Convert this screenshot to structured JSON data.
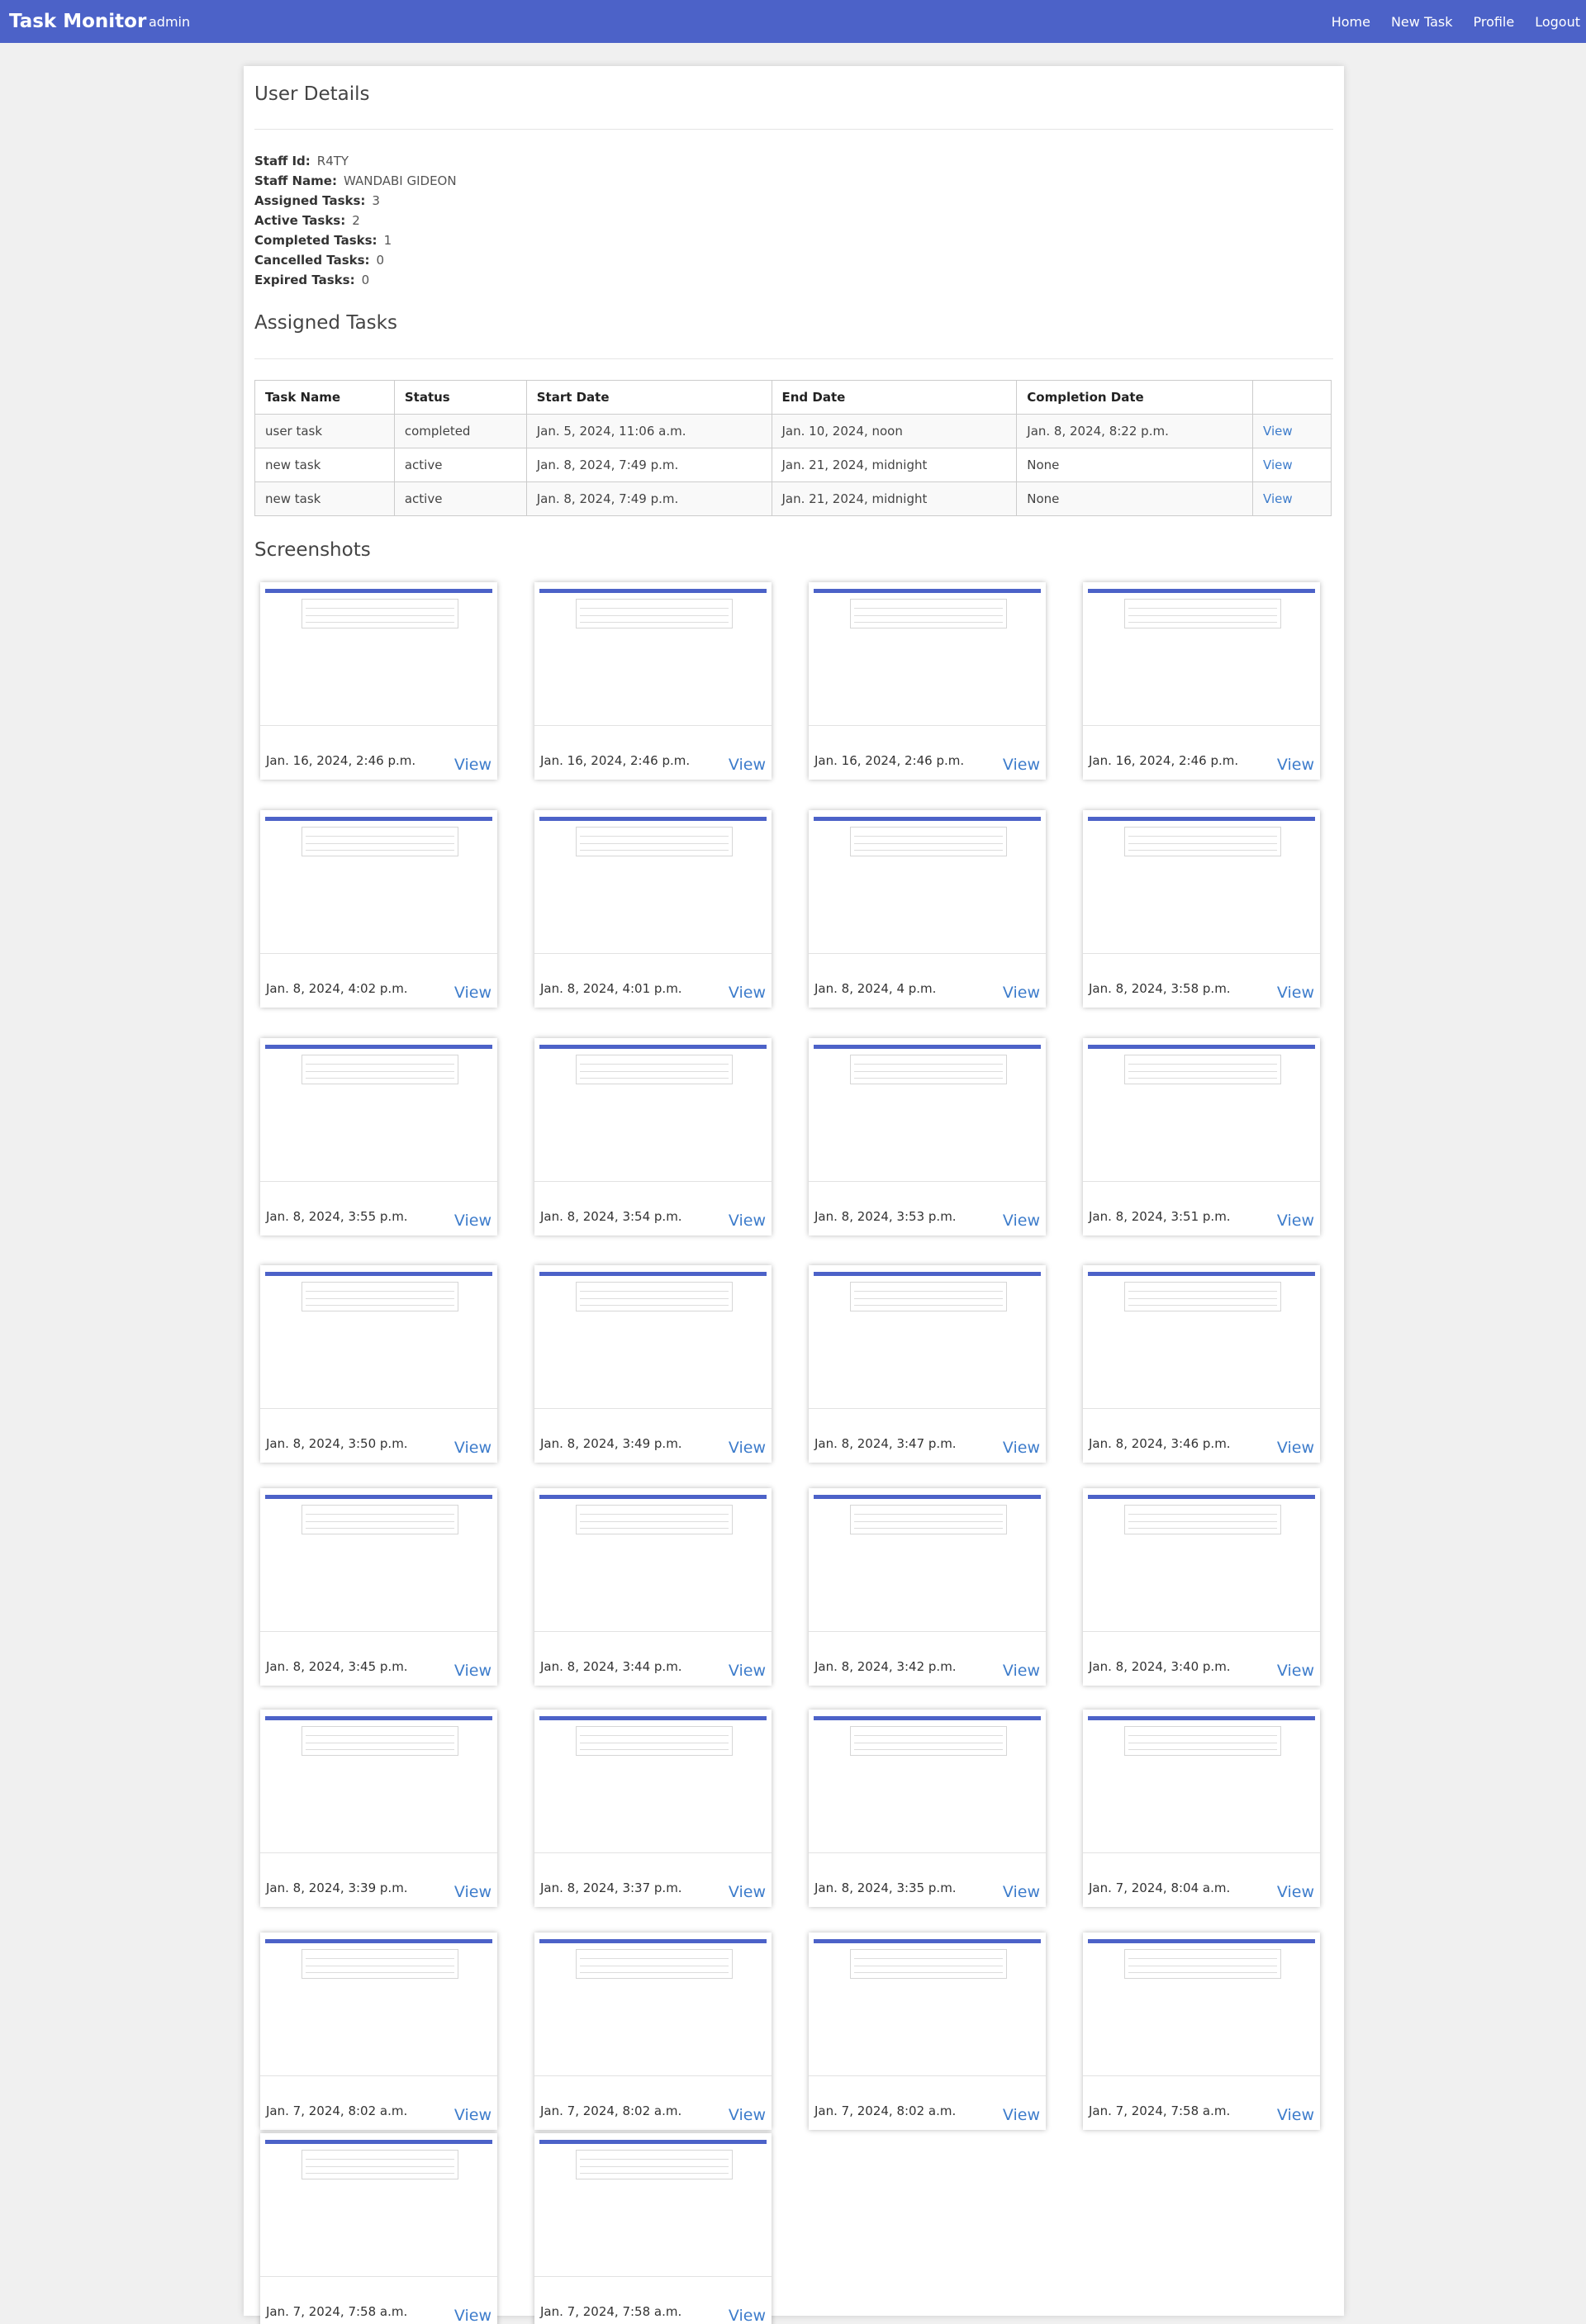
{
  "navbar": {
    "brand": "Task Monitor",
    "user": "admin",
    "links": [
      "Home",
      "New Task",
      "Profile",
      "Logout"
    ]
  },
  "user_details": {
    "heading": "User Details",
    "fields": [
      {
        "key": "Staff Id:",
        "value": "R4TY"
      },
      {
        "key": "Staff Name:",
        "value": "WANDABI GIDEON"
      },
      {
        "key": "Assigned Tasks:",
        "value": "3"
      },
      {
        "key": "Active Tasks:",
        "value": "2"
      },
      {
        "key": "Completed Tasks:",
        "value": "1"
      },
      {
        "key": "Cancelled Tasks:",
        "value": "0"
      },
      {
        "key": "Expired Tasks:",
        "value": "0"
      }
    ]
  },
  "assigned_tasks": {
    "heading": "Assigned Tasks",
    "columns": [
      "Task Name",
      "Status",
      "Start Date",
      "End Date",
      "Completion Date",
      ""
    ],
    "rows": [
      [
        "user task",
        "completed",
        "Jan. 5, 2024, 11:06 a.m.",
        "Jan. 10, 2024, noon",
        "Jan. 8, 2024, 8:22 p.m.",
        "View"
      ],
      [
        "new task",
        "active",
        "Jan. 8, 2024, 7:49 p.m.",
        "Jan. 21, 2024, midnight",
        "None",
        "View"
      ],
      [
        "new task",
        "active",
        "Jan. 8, 2024, 7:49 p.m.",
        "Jan. 21, 2024, midnight",
        "None",
        "View"
      ]
    ]
  },
  "screenshots": {
    "heading": "Screenshots",
    "view_label": "View",
    "items": [
      "Jan. 16, 2024, 2:46 p.m.",
      "Jan. 16, 2024, 2:46 p.m.",
      "Jan. 16, 2024, 2:46 p.m.",
      "Jan. 16, 2024, 2:46 p.m.",
      "Jan. 8, 2024, 4:02 p.m.",
      "Jan. 8, 2024, 4:01 p.m.",
      "Jan. 8, 2024, 4 p.m.",
      "Jan. 8, 2024, 3:58 p.m.",
      "Jan. 8, 2024, 3:55 p.m.",
      "Jan. 8, 2024, 3:54 p.m.",
      "Jan. 8, 2024, 3:53 p.m.",
      "Jan. 8, 2024, 3:51 p.m.",
      "Jan. 8, 2024, 3:50 p.m.",
      "Jan. 8, 2024, 3:49 p.m.",
      "Jan. 8, 2024, 3:47 p.m.",
      "Jan. 8, 2024, 3:46 p.m.",
      "Jan. 8, 2024, 3:45 p.m.",
      "Jan. 8, 2024, 3:44 p.m.",
      "Jan. 8, 2024, 3:42 p.m.",
      "Jan. 8, 2024, 3:40 p.m.",
      "Jan. 8, 2024, 3:39 p.m.",
      "Jan. 8, 2024, 3:37 p.m.",
      "Jan. 8, 2024, 3:35 p.m.",
      "Jan. 7, 2024, 8:04 a.m.",
      "Jan. 7, 2024, 8:02 a.m.",
      "Jan. 7, 2024, 8:02 a.m.",
      "Jan. 7, 2024, 8:02 a.m.",
      "Jan. 7, 2024, 7:58 a.m.",
      "Jan. 7, 2024, 7:58 a.m.",
      "Jan. 7, 2024, 7:58 a.m."
    ]
  },
  "colors": {
    "navbar": "#4c62c8",
    "link": "#3d7ccb"
  }
}
